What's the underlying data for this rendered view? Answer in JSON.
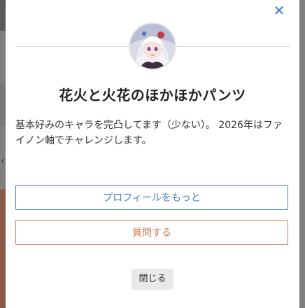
{
  "modal": {
    "close_icon_glyph": "✕",
    "avatar_icon": "anime-character-avatar",
    "user_name": "花火と火花のほかほかパンツ",
    "bio": "基本好みのキャラを完凸してます（少ない）。 2026年はファイノン軸でチャレンジします。",
    "profile_button_label": "プロフィールをもっと",
    "question_button_label": "質問する",
    "close_button_label": "閉じる"
  },
  "colors": {
    "accent_blue": "#4a7ec0",
    "accent_orange": "#d27a55",
    "close_icon": "#3d74c9"
  }
}
